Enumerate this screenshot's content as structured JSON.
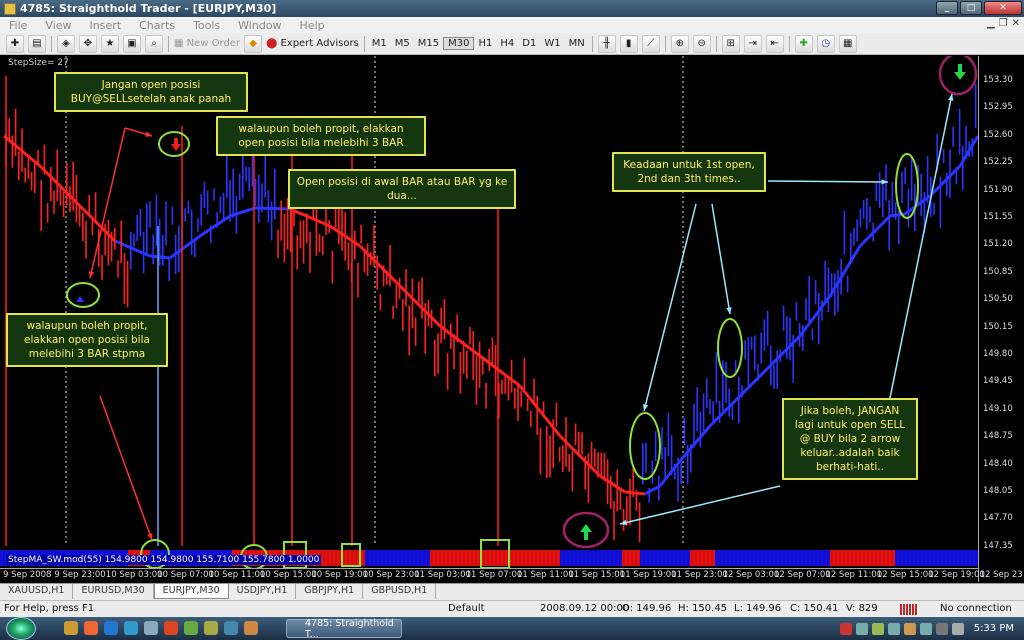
{
  "window": {
    "title": "4785: Straighthold Trader - [EURJPY,M30]",
    "controls": [
      "_",
      "□",
      "✕"
    ]
  },
  "menu": [
    "File",
    "View",
    "Insert",
    "Charts",
    "Tools",
    "Window",
    "Help"
  ],
  "toolbar": {
    "new_order": "New Order",
    "expert_advisors": "Expert Advisors",
    "timeframes": [
      "M1",
      "M5",
      "M15",
      "M30",
      "H1",
      "H4",
      "D1",
      "W1",
      "MN"
    ],
    "active_timeframe": "M30"
  },
  "chart": {
    "stepsize_label": "StepSize= 27",
    "indicator_label": "StepMA_SW.mod(55) 154.9800 154.9800 155.7100 155.7800 1.0000",
    "y_ticks": [
      "153.30",
      "152.95",
      "152.60",
      "152.25",
      "151.90",
      "151.55",
      "151.20",
      "150.85",
      "150.50",
      "150.15",
      "149.80",
      "149.45",
      "149.10",
      "148.75",
      "148.40",
      "148.05",
      "147.70",
      "147.35"
    ],
    "x_ticks": [
      "9 Sep 2008",
      "9 Sep 23:00",
      "10 Sep 03:00",
      "10 Sep 07:00",
      "10 Sep 11:00",
      "10 Sep 15:00",
      "10 Sep 19:00",
      "10 Sep 23:00",
      "11 Sep 03:00",
      "11 Sep 07:00",
      "11 Sep 11:00",
      "11 Sep 15:00",
      "11 Sep 19:00",
      "11 Sep 23:00",
      "12 Sep 03:00",
      "12 Sep 07:00",
      "12 Sep 11:00",
      "12 Sep 15:00",
      "12 Sep 19:00",
      "12 Sep 23"
    ],
    "colors": {
      "up": "#2a35ff",
      "down": "#ff2020",
      "callout_border": "#e4e44c",
      "highlight": "#8ee23a"
    }
  },
  "callouts": [
    {
      "id": "c1",
      "text": "Jangan open posisi BUY@SELLsetelah anak panah"
    },
    {
      "id": "c2",
      "text": "walaupun boleh propit, elakkan open posisi bila melebihi 3 BAR"
    },
    {
      "id": "c3",
      "text": "Open posisi di awal BAR atau BAR yg ke dua..."
    },
    {
      "id": "c4",
      "text": "Keadaan untuk 1st open, 2nd dan 3th times.."
    },
    {
      "id": "c5",
      "text": "walaupun boleh propit, elakkan open posisi bila melebihi 3 BAR stpma"
    },
    {
      "id": "c6",
      "text": "Jika boleh, JANGAN lagi untuk open SELL @ BUY bila 2 arrow keluar..adalah baik berhati-hati.."
    }
  ],
  "tabs": [
    "XAUUSD,H1",
    "EURUSD,M30",
    "EURJPY,M30",
    "USDJPY,H1",
    "GBPJPY,H1",
    "GBPUSD,H1"
  ],
  "active_tab": "EURJPY,M30",
  "status": {
    "help": "For Help, press F1",
    "profile": "Default",
    "datetime": "2008.09.12 00:00",
    "open": "O: 149.96",
    "high": "H: 150.45",
    "low": "L: 149.96",
    "close": "C: 150.41",
    "volume": "V: 829",
    "connection": "No connection"
  },
  "taskbar": {
    "task": "4785: Straighthold T...",
    "clock": "5:33 PM"
  }
}
